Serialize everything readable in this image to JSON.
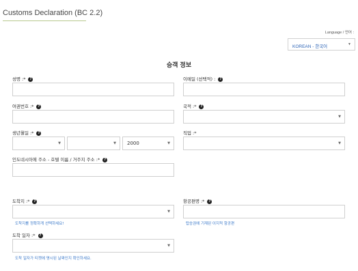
{
  "header": {
    "title": "Customs Declaration (BC 2.2)"
  },
  "language": {
    "label": "Language / 언어 :",
    "selected": "KOREAN - 한국어"
  },
  "section": {
    "title": "승객 정보"
  },
  "fields": {
    "name": {
      "label": "성명 :*"
    },
    "email": {
      "label": "이메일 (선택적) :"
    },
    "passport": {
      "label": "여권번호 :*"
    },
    "nationality": {
      "label": "국적 :*"
    },
    "dob": {
      "label": "생년월일 :*",
      "year": "2000"
    },
    "occupation": {
      "label": "직업 :*"
    },
    "address": {
      "label": "인도네시아에 주소 - 호텔 이름 / 거주지 주소 :*"
    },
    "arrival_place": {
      "label": "도착지 :*",
      "hint": "도착지를 정확하게 선택하세요!"
    },
    "flight": {
      "label": "항공편명 :*",
      "hint": "탑승권에 기재된 이지적 항공편"
    },
    "arrival_date": {
      "label": "도착 일자 :*",
      "hint": "도착 일자가 티켓에 명시된 날짜인지 확인하세요."
    }
  },
  "icons": {
    "help": "question-circle-icon",
    "dropdown": "chevron-down-icon"
  }
}
